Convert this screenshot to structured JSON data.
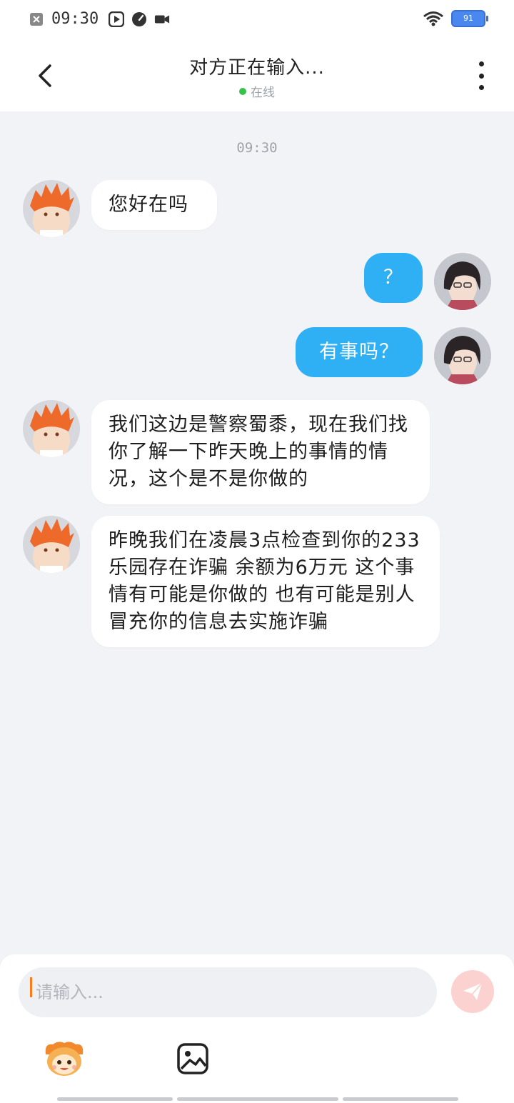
{
  "status_bar": {
    "time": "09:30",
    "battery": "91",
    "icons": [
      "close-box-icon",
      "play-icon",
      "speedometer-icon",
      "video-camera-icon",
      "wifi-icon",
      "battery-icon"
    ]
  },
  "header": {
    "title": "对方正在输入...",
    "status": "在线",
    "status_color": "#36c24b",
    "back_icon": "chevron-left-icon",
    "more_icon": "more-vertical-icon"
  },
  "chat": {
    "timestamp": "09:30",
    "messages": [
      {
        "sender": "other",
        "text": "您好在吗"
      },
      {
        "sender": "me",
        "text": "？"
      },
      {
        "sender": "me",
        "text": "有事吗？"
      },
      {
        "sender": "other",
        "text": "我们这边是警察蜀黍，现在我们找你了解一下昨天晚上的事情的情况，这个是不是你做的"
      },
      {
        "sender": "other",
        "text": "昨晚我们在凌晨3点检查到你的233乐园存在诈骗 余额为6万元 这个事情有可能是你做的 也有可能是别人 冒充你的信息去实施诈骗"
      }
    ]
  },
  "input": {
    "placeholder": "请输入...",
    "value": "",
    "send_icon": "send-icon",
    "emoji_icon": "emoji-mascot-icon",
    "image_icon": "image-icon"
  },
  "colors": {
    "accent": "#2fb0f5",
    "background": "#f2f3f7",
    "send_disabled": "#fbd2cf"
  }
}
